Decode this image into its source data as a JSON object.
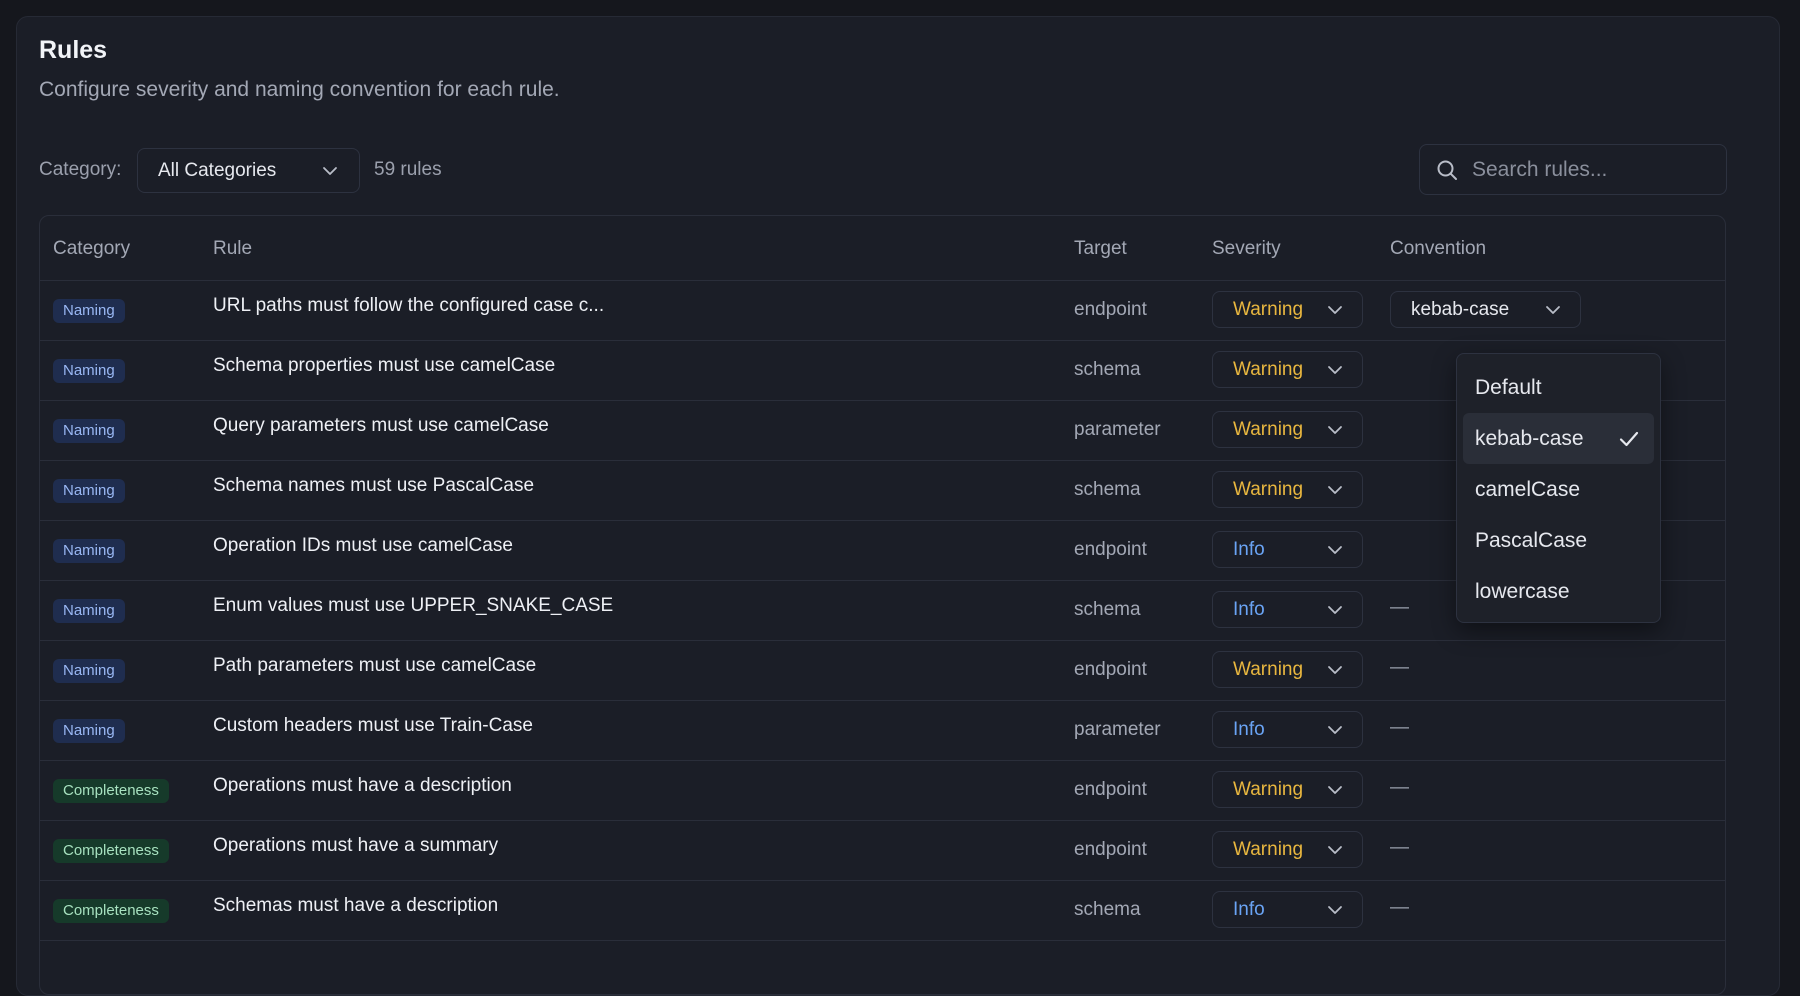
{
  "header": {
    "title": "Rules",
    "subtitle": "Configure severity and naming convention for each rule."
  },
  "filter": {
    "label": "Category:",
    "selected": "All Categories",
    "count": "59 rules"
  },
  "search": {
    "placeholder": "Search rules..."
  },
  "table": {
    "columns": [
      "Category",
      "Rule",
      "Target",
      "Severity",
      "Convention"
    ],
    "rows": [
      {
        "category": "Naming",
        "rule": "URL paths must follow the configured case c...",
        "target": "endpoint",
        "severity": "Warning",
        "convention": "kebab-case"
      },
      {
        "category": "Naming",
        "rule": "Schema properties must use camelCase",
        "target": "schema",
        "severity": "Warning",
        "convention": ""
      },
      {
        "category": "Naming",
        "rule": "Query parameters must use camelCase",
        "target": "parameter",
        "severity": "Warning",
        "convention": ""
      },
      {
        "category": "Naming",
        "rule": "Schema names must use PascalCase",
        "target": "schema",
        "severity": "Warning",
        "convention": ""
      },
      {
        "category": "Naming",
        "rule": "Operation IDs must use camelCase",
        "target": "endpoint",
        "severity": "Info",
        "convention": ""
      },
      {
        "category": "Naming",
        "rule": "Enum values must use UPPER_SNAKE_CASE",
        "target": "schema",
        "severity": "Info",
        "convention": "—"
      },
      {
        "category": "Naming",
        "rule": "Path parameters must use camelCase",
        "target": "endpoint",
        "severity": "Warning",
        "convention": "—"
      },
      {
        "category": "Naming",
        "rule": "Custom headers must use Train-Case",
        "target": "parameter",
        "severity": "Info",
        "convention": "—"
      },
      {
        "category": "Completeness",
        "rule": "Operations must have a description",
        "target": "endpoint",
        "severity": "Warning",
        "convention": "—"
      },
      {
        "category": "Completeness",
        "rule": "Operations must have a summary",
        "target": "endpoint",
        "severity": "Warning",
        "convention": "—"
      },
      {
        "category": "Completeness",
        "rule": "Schemas must have a description",
        "target": "schema",
        "severity": "Info",
        "convention": "—"
      }
    ]
  },
  "convention_dropdown": {
    "options": [
      "Default",
      "kebab-case",
      "camelCase",
      "PascalCase",
      "lowercase"
    ],
    "selected": "kebab-case"
  },
  "colors": {
    "warning": "#e9b73f",
    "info": "#6aa4f5",
    "naming_badge": "#1f2d4f",
    "completeness_badge": "#163a2a"
  },
  "icons": [
    "chevron-down-icon",
    "search-icon",
    "check-icon"
  ]
}
